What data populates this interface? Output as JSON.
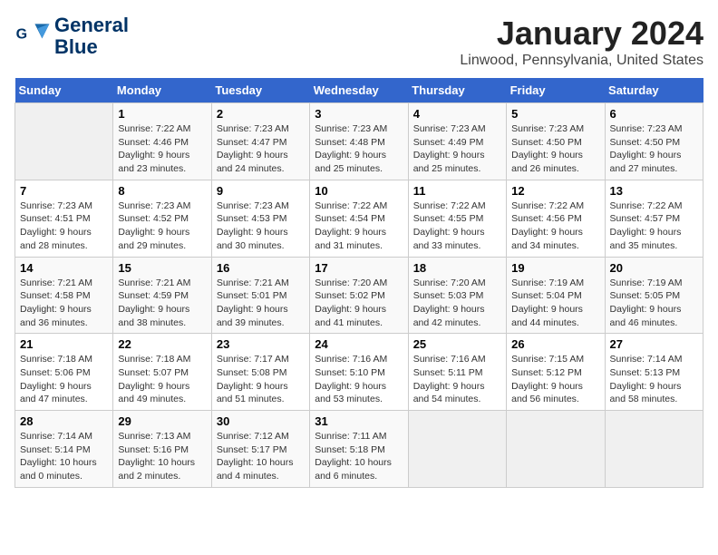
{
  "header": {
    "logo_line1": "General",
    "logo_line2": "Blue",
    "title": "January 2024",
    "subtitle": "Linwood, Pennsylvania, United States"
  },
  "days_of_week": [
    "Sunday",
    "Monday",
    "Tuesday",
    "Wednesday",
    "Thursday",
    "Friday",
    "Saturday"
  ],
  "weeks": [
    [
      {
        "num": "",
        "empty": true
      },
      {
        "num": "1",
        "sunrise": "7:22 AM",
        "sunset": "4:46 PM",
        "daylight": "9 hours and 23 minutes."
      },
      {
        "num": "2",
        "sunrise": "7:23 AM",
        "sunset": "4:47 PM",
        "daylight": "9 hours and 24 minutes."
      },
      {
        "num": "3",
        "sunrise": "7:23 AM",
        "sunset": "4:48 PM",
        "daylight": "9 hours and 25 minutes."
      },
      {
        "num": "4",
        "sunrise": "7:23 AM",
        "sunset": "4:49 PM",
        "daylight": "9 hours and 25 minutes."
      },
      {
        "num": "5",
        "sunrise": "7:23 AM",
        "sunset": "4:50 PM",
        "daylight": "9 hours and 26 minutes."
      },
      {
        "num": "6",
        "sunrise": "7:23 AM",
        "sunset": "4:50 PM",
        "daylight": "9 hours and 27 minutes."
      }
    ],
    [
      {
        "num": "7",
        "sunrise": "7:23 AM",
        "sunset": "4:51 PM",
        "daylight": "9 hours and 28 minutes."
      },
      {
        "num": "8",
        "sunrise": "7:23 AM",
        "sunset": "4:52 PM",
        "daylight": "9 hours and 29 minutes."
      },
      {
        "num": "9",
        "sunrise": "7:23 AM",
        "sunset": "4:53 PM",
        "daylight": "9 hours and 30 minutes."
      },
      {
        "num": "10",
        "sunrise": "7:22 AM",
        "sunset": "4:54 PM",
        "daylight": "9 hours and 31 minutes."
      },
      {
        "num": "11",
        "sunrise": "7:22 AM",
        "sunset": "4:55 PM",
        "daylight": "9 hours and 33 minutes."
      },
      {
        "num": "12",
        "sunrise": "7:22 AM",
        "sunset": "4:56 PM",
        "daylight": "9 hours and 34 minutes."
      },
      {
        "num": "13",
        "sunrise": "7:22 AM",
        "sunset": "4:57 PM",
        "daylight": "9 hours and 35 minutes."
      }
    ],
    [
      {
        "num": "14",
        "sunrise": "7:21 AM",
        "sunset": "4:58 PM",
        "daylight": "9 hours and 36 minutes."
      },
      {
        "num": "15",
        "sunrise": "7:21 AM",
        "sunset": "4:59 PM",
        "daylight": "9 hours and 38 minutes."
      },
      {
        "num": "16",
        "sunrise": "7:21 AM",
        "sunset": "5:01 PM",
        "daylight": "9 hours and 39 minutes."
      },
      {
        "num": "17",
        "sunrise": "7:20 AM",
        "sunset": "5:02 PM",
        "daylight": "9 hours and 41 minutes."
      },
      {
        "num": "18",
        "sunrise": "7:20 AM",
        "sunset": "5:03 PM",
        "daylight": "9 hours and 42 minutes."
      },
      {
        "num": "19",
        "sunrise": "7:19 AM",
        "sunset": "5:04 PM",
        "daylight": "9 hours and 44 minutes."
      },
      {
        "num": "20",
        "sunrise": "7:19 AM",
        "sunset": "5:05 PM",
        "daylight": "9 hours and 46 minutes."
      }
    ],
    [
      {
        "num": "21",
        "sunrise": "7:18 AM",
        "sunset": "5:06 PM",
        "daylight": "9 hours and 47 minutes."
      },
      {
        "num": "22",
        "sunrise": "7:18 AM",
        "sunset": "5:07 PM",
        "daylight": "9 hours and 49 minutes."
      },
      {
        "num": "23",
        "sunrise": "7:17 AM",
        "sunset": "5:08 PM",
        "daylight": "9 hours and 51 minutes."
      },
      {
        "num": "24",
        "sunrise": "7:16 AM",
        "sunset": "5:10 PM",
        "daylight": "9 hours and 53 minutes."
      },
      {
        "num": "25",
        "sunrise": "7:16 AM",
        "sunset": "5:11 PM",
        "daylight": "9 hours and 54 minutes."
      },
      {
        "num": "26",
        "sunrise": "7:15 AM",
        "sunset": "5:12 PM",
        "daylight": "9 hours and 56 minutes."
      },
      {
        "num": "27",
        "sunrise": "7:14 AM",
        "sunset": "5:13 PM",
        "daylight": "9 hours and 58 minutes."
      }
    ],
    [
      {
        "num": "28",
        "sunrise": "7:14 AM",
        "sunset": "5:14 PM",
        "daylight": "10 hours and 0 minutes."
      },
      {
        "num": "29",
        "sunrise": "7:13 AM",
        "sunset": "5:16 PM",
        "daylight": "10 hours and 2 minutes."
      },
      {
        "num": "30",
        "sunrise": "7:12 AM",
        "sunset": "5:17 PM",
        "daylight": "10 hours and 4 minutes."
      },
      {
        "num": "31",
        "sunrise": "7:11 AM",
        "sunset": "5:18 PM",
        "daylight": "10 hours and 6 minutes."
      },
      {
        "num": "",
        "empty": true
      },
      {
        "num": "",
        "empty": true
      },
      {
        "num": "",
        "empty": true
      }
    ]
  ]
}
